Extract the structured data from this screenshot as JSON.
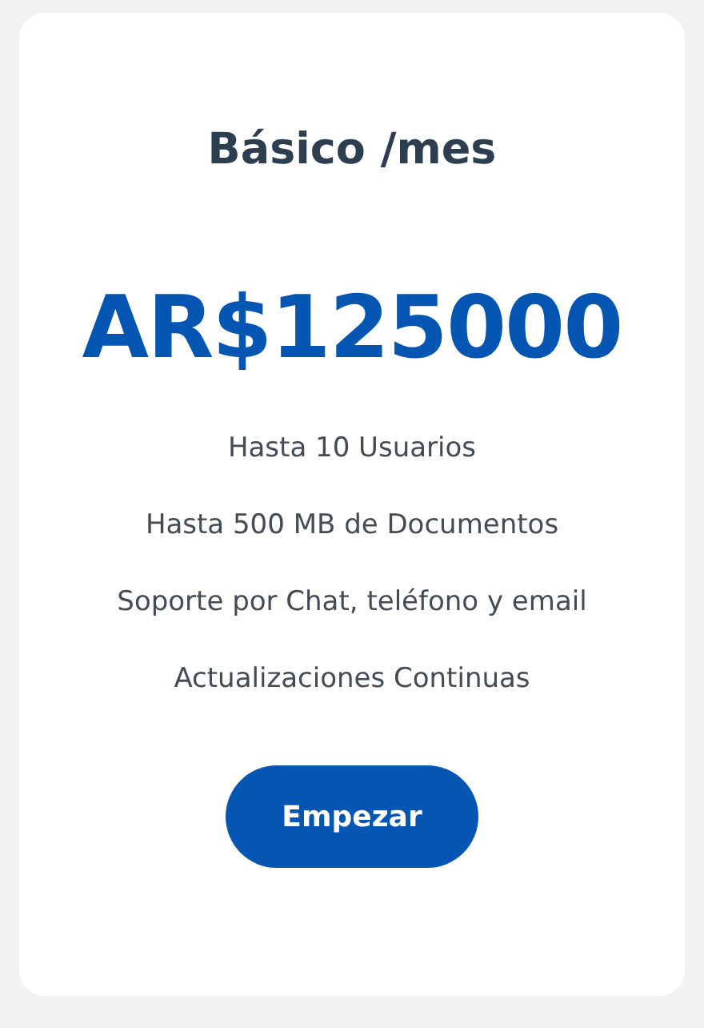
{
  "plan": {
    "title": "Básico /mes",
    "price": "AR$125000",
    "features": [
      "Hasta 10 Usuarios",
      "Hasta 500 MB de Documentos",
      "Soporte por Chat, teléfono y email",
      "Actualizaciones Continuas"
    ],
    "button": "Empezar"
  }
}
